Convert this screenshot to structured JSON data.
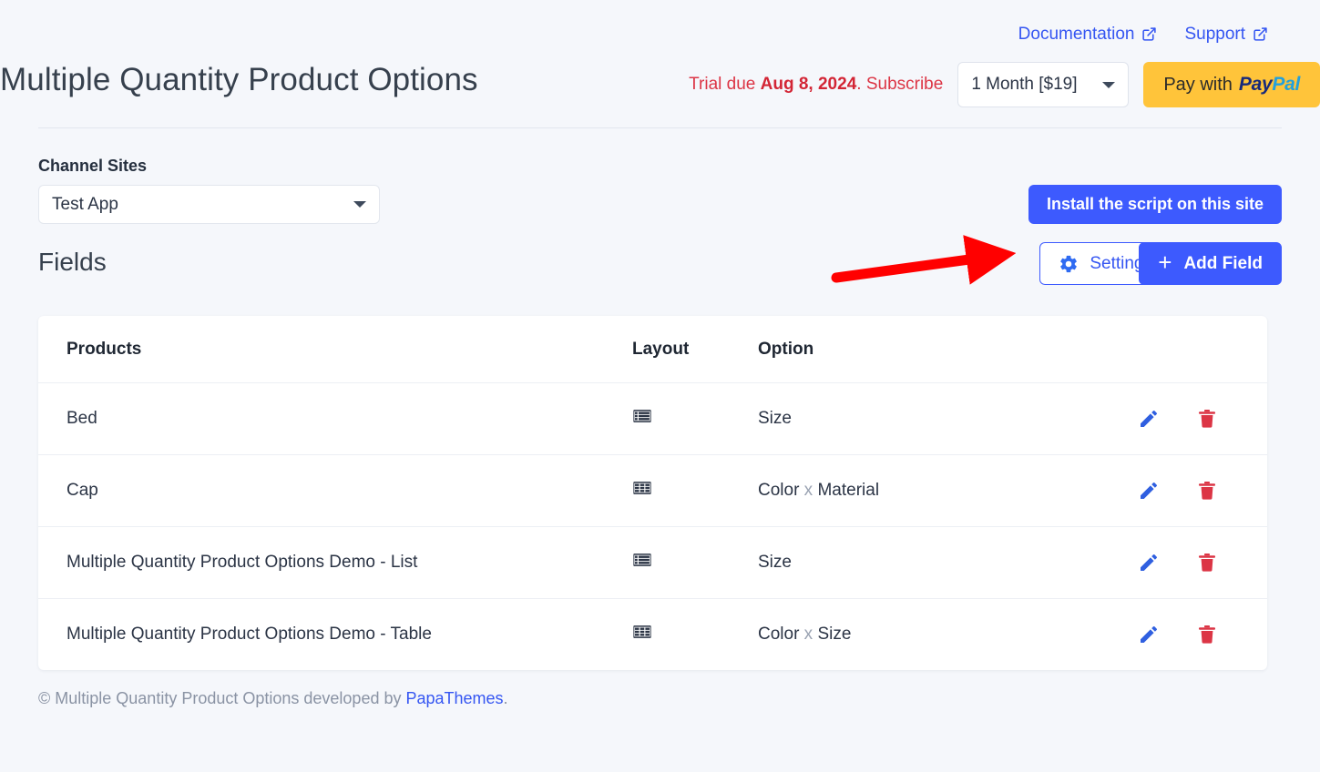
{
  "top_links": [
    {
      "label": "Documentation",
      "icon": "external-link-icon"
    },
    {
      "label": "Support",
      "icon": "external-link-icon"
    }
  ],
  "header": {
    "title": "Multiple Quantity Product Options",
    "trial_prefix": "Trial due ",
    "trial_date": "Aug 8, 2024",
    "trial_suffix": ". Subscribe",
    "plan_selected": "1 Month [$19]",
    "paypal_label": "Pay with",
    "paypal_brand_1": "Pay",
    "paypal_brand_2": "Pal"
  },
  "channel": {
    "label": "Channel Sites",
    "selected_site": "Test App",
    "install_label": "Install the script on this site"
  },
  "fields": {
    "title": "Fields",
    "settings_label": "Settings",
    "settings_icon": "gear-icon",
    "add_field_label": "Add Field",
    "add_field_icon": "plus-icon"
  },
  "table": {
    "columns": [
      "Products",
      "Layout",
      "Option"
    ],
    "rows": [
      {
        "product": "Bed",
        "layout_icon": "list-layout-icon",
        "option_primary": "Size",
        "option_separator": "",
        "option_secondary": "",
        "edit_icon": "pencil-icon",
        "delete_icon": "trash-icon"
      },
      {
        "product": "Cap",
        "layout_icon": "grid-layout-icon",
        "option_primary": "Color",
        "option_separator": " x ",
        "option_secondary": "Material",
        "edit_icon": "pencil-icon",
        "delete_icon": "trash-icon"
      },
      {
        "product": "Multiple Quantity Product Options Demo - List",
        "layout_icon": "list-layout-icon",
        "option_primary": "Size",
        "option_separator": "",
        "option_secondary": "",
        "edit_icon": "pencil-icon",
        "delete_icon": "trash-icon"
      },
      {
        "product": "Multiple Quantity Product Options Demo - Table",
        "layout_icon": "grid-layout-icon",
        "option_primary": "Color",
        "option_separator": " x ",
        "option_secondary": "Size",
        "edit_icon": "pencil-icon",
        "delete_icon": "trash-icon"
      }
    ]
  },
  "footer": {
    "text_before": "© Multiple Quantity Product Options developed by ",
    "link": "PapaThemes",
    "text_after": "."
  },
  "annotation": {
    "type": "arrow",
    "color": "#ff0000",
    "points_at": "settings-button"
  },
  "colors": {
    "primary_blue": "#3d5afe",
    "link_blue": "#3556f2",
    "danger_red": "#dc3545",
    "paypal_yellow": "#ffc43a",
    "page_bg": "#f5f7fb"
  }
}
